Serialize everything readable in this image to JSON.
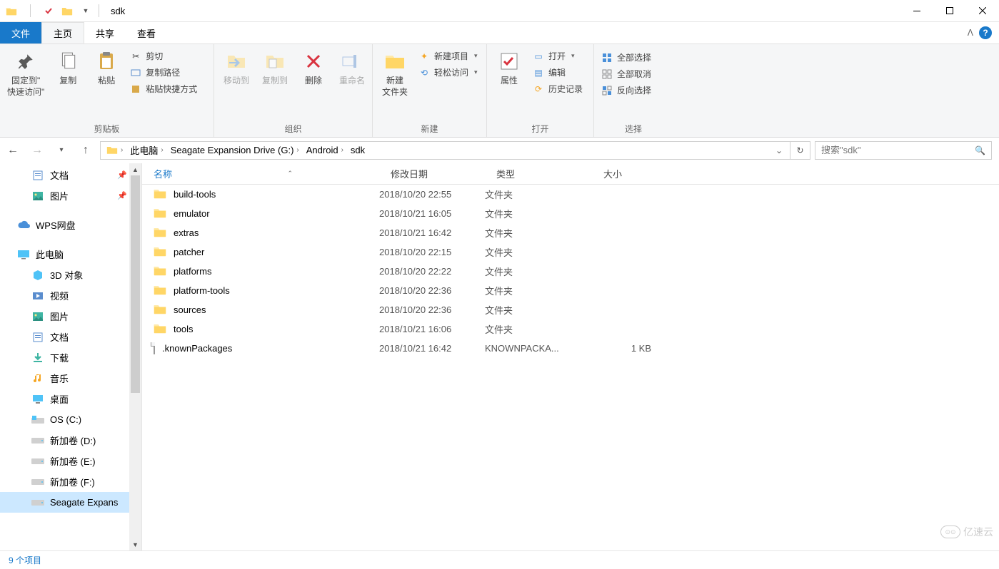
{
  "window": {
    "title": "sdk"
  },
  "tabs": {
    "file": "文件",
    "home": "主页",
    "share": "共享",
    "view": "查看"
  },
  "ribbon": {
    "clipboard": {
      "pin": "固定到\"\n快速访问\"",
      "copy": "复制",
      "paste": "粘贴",
      "cut": "剪切",
      "copypath": "复制路径",
      "pasteshortcut": "粘贴快捷方式",
      "label": "剪贴板"
    },
    "organize": {
      "moveto": "移动到",
      "copyto": "复制到",
      "delete": "删除",
      "rename": "重命名",
      "label": "组织"
    },
    "new": {
      "newfolder": "新建\n文件夹",
      "newitem": "新建项目",
      "easyaccess": "轻松访问",
      "label": "新建"
    },
    "open": {
      "properties": "属性",
      "open": "打开",
      "edit": "编辑",
      "history": "历史记录",
      "label": "打开"
    },
    "select": {
      "selectall": "全部选择",
      "selectnone": "全部取消",
      "invertsel": "反向选择",
      "label": "选择"
    }
  },
  "breadcrumb": [
    "此电脑",
    "Seagate Expansion Drive (G:)",
    "Android",
    "sdk"
  ],
  "search": {
    "placeholder": "搜索\"sdk\""
  },
  "sidebar": {
    "quick": [
      {
        "label": "文档",
        "pin": true,
        "ico": "doc"
      },
      {
        "label": "图片",
        "pin": true,
        "ico": "pic"
      }
    ],
    "wps": "WPS网盘",
    "thispc": "此电脑",
    "pcitems": [
      {
        "label": "3D 对象",
        "ico": "cube"
      },
      {
        "label": "视频",
        "ico": "video"
      },
      {
        "label": "图片",
        "ico": "pic"
      },
      {
        "label": "文档",
        "ico": "doc"
      },
      {
        "label": "下载",
        "ico": "download"
      },
      {
        "label": "音乐",
        "ico": "music"
      },
      {
        "label": "桌面",
        "ico": "desktop"
      },
      {
        "label": "OS (C:)",
        "ico": "drive-win"
      },
      {
        "label": "新加卷 (D:)",
        "ico": "drive"
      },
      {
        "label": "新加卷 (E:)",
        "ico": "drive"
      },
      {
        "label": "新加卷 (F:)",
        "ico": "drive"
      },
      {
        "label": "Seagate Expans",
        "ico": "drive",
        "selected": true
      }
    ]
  },
  "columns": {
    "name": "名称",
    "date": "修改日期",
    "type": "类型",
    "size": "大小"
  },
  "files": [
    {
      "name": "build-tools",
      "date": "2018/10/20 22:55",
      "type": "文件夹",
      "size": "",
      "kind": "folder"
    },
    {
      "name": "emulator",
      "date": "2018/10/21 16:05",
      "type": "文件夹",
      "size": "",
      "kind": "folder"
    },
    {
      "name": "extras",
      "date": "2018/10/21 16:42",
      "type": "文件夹",
      "size": "",
      "kind": "folder"
    },
    {
      "name": "patcher",
      "date": "2018/10/20 22:15",
      "type": "文件夹",
      "size": "",
      "kind": "folder"
    },
    {
      "name": "platforms",
      "date": "2018/10/20 22:22",
      "type": "文件夹",
      "size": "",
      "kind": "folder"
    },
    {
      "name": "platform-tools",
      "date": "2018/10/20 22:36",
      "type": "文件夹",
      "size": "",
      "kind": "folder"
    },
    {
      "name": "sources",
      "date": "2018/10/20 22:36",
      "type": "文件夹",
      "size": "",
      "kind": "folder"
    },
    {
      "name": "tools",
      "date": "2018/10/21 16:06",
      "type": "文件夹",
      "size": "",
      "kind": "folder"
    },
    {
      "name": ".knownPackages",
      "date": "2018/10/21 16:42",
      "type": "KNOWNPACKA...",
      "size": "1 KB",
      "kind": "file"
    }
  ],
  "status": "9 个项目",
  "watermark": "亿速云"
}
